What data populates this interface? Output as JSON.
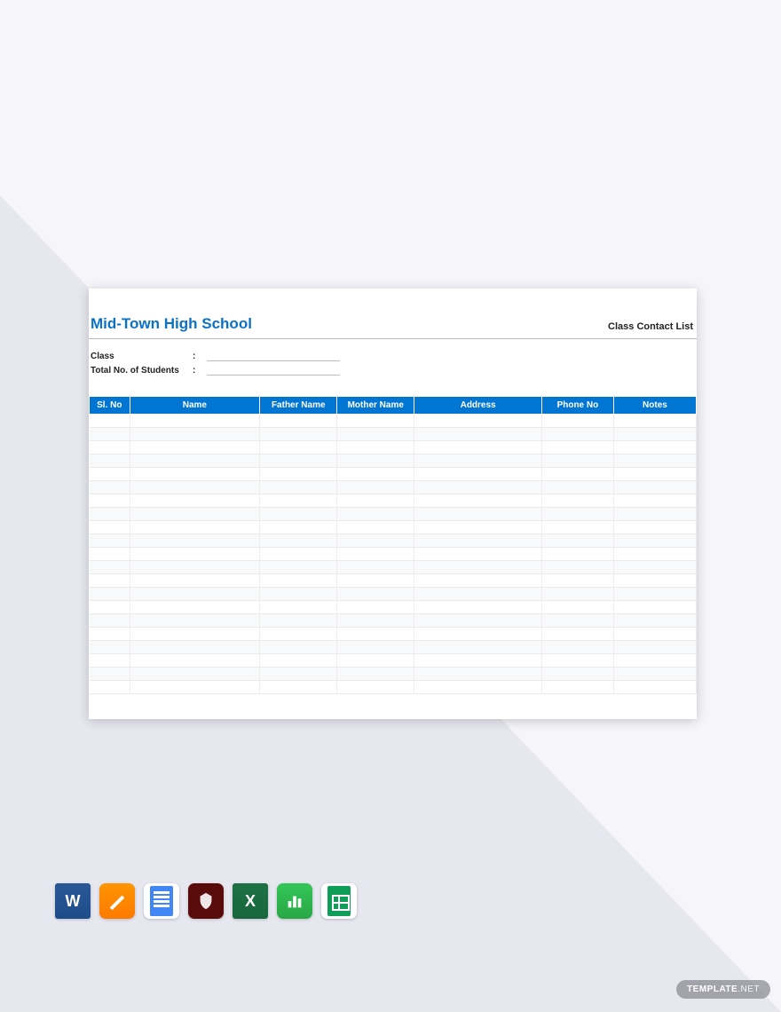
{
  "document": {
    "title": "Mid-Town High School",
    "subtitle": "Class Contact List",
    "fields": [
      {
        "label": "Class"
      },
      {
        "label": "Total No. of Students"
      }
    ],
    "columns": [
      "Sl. No",
      "Name",
      "Father Name",
      "Mother Name",
      "Address",
      "Phone No",
      "Notes"
    ],
    "row_count": 21
  },
  "watermark": {
    "brand": "TEMPLATE",
    "suffix": ".NET"
  }
}
